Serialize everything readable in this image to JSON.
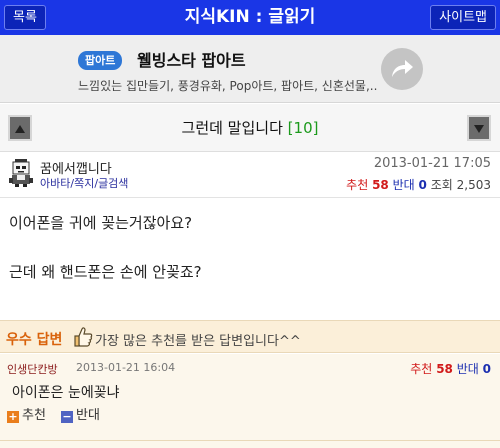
{
  "header": {
    "title": "지식KIN : 글읽기",
    "left_button": "목록",
    "right_button": "사이트맵"
  },
  "ad": {
    "tag": "팝아트",
    "title": "웰빙스타 팝아트",
    "subtitle": "느낌있는 집만들기, 풍경유화, Pop아트, 팝아트, 신혼선물,..."
  },
  "nav": {
    "title": "그런데 말입니다",
    "count": "[10]"
  },
  "post": {
    "author": "꿈에서깹니다",
    "links": [
      "아바타",
      "쪽지",
      "글검색"
    ],
    "date": "2013-01-21 17:05",
    "recommend_label": "추천",
    "recommend_count": "58",
    "oppose_label": "반대",
    "oppose_count": "0",
    "views_label": "조회",
    "views_count": "2,503",
    "body": [
      "이어폰을 귀에 꽂는거잖아요?",
      "근데 왜 핸드폰은 손에 안꽂죠?"
    ]
  },
  "best_answer": {
    "badge_1": "우수",
    "badge_2": "답변",
    "message": "가장 많은 추천를 받은 답변입니다^^"
  },
  "answer": {
    "author": "인생단칸방",
    "date": "2013-01-21 16:04",
    "recommend_label": "추천",
    "recommend_count": "58",
    "oppose_label": "반대",
    "oppose_count": "0",
    "text": "아이폰은 눈에꽂냐",
    "vote_up_label": "추천",
    "vote_down_label": "반대"
  },
  "colors": {
    "header_bg": "#1a36e6",
    "count_green": "#1c9a1c",
    "recommend_red": "#d11a1a",
    "oppose_blue": "#1c2fb0",
    "best_orange": "#d9620b"
  },
  "icons": {
    "avatar": "pixel-person-icon",
    "ad_arrow": "share-arrow-icon",
    "prev": "triangle-up-icon",
    "next": "triangle-down-icon",
    "best": "thumbs-up-icon"
  }
}
